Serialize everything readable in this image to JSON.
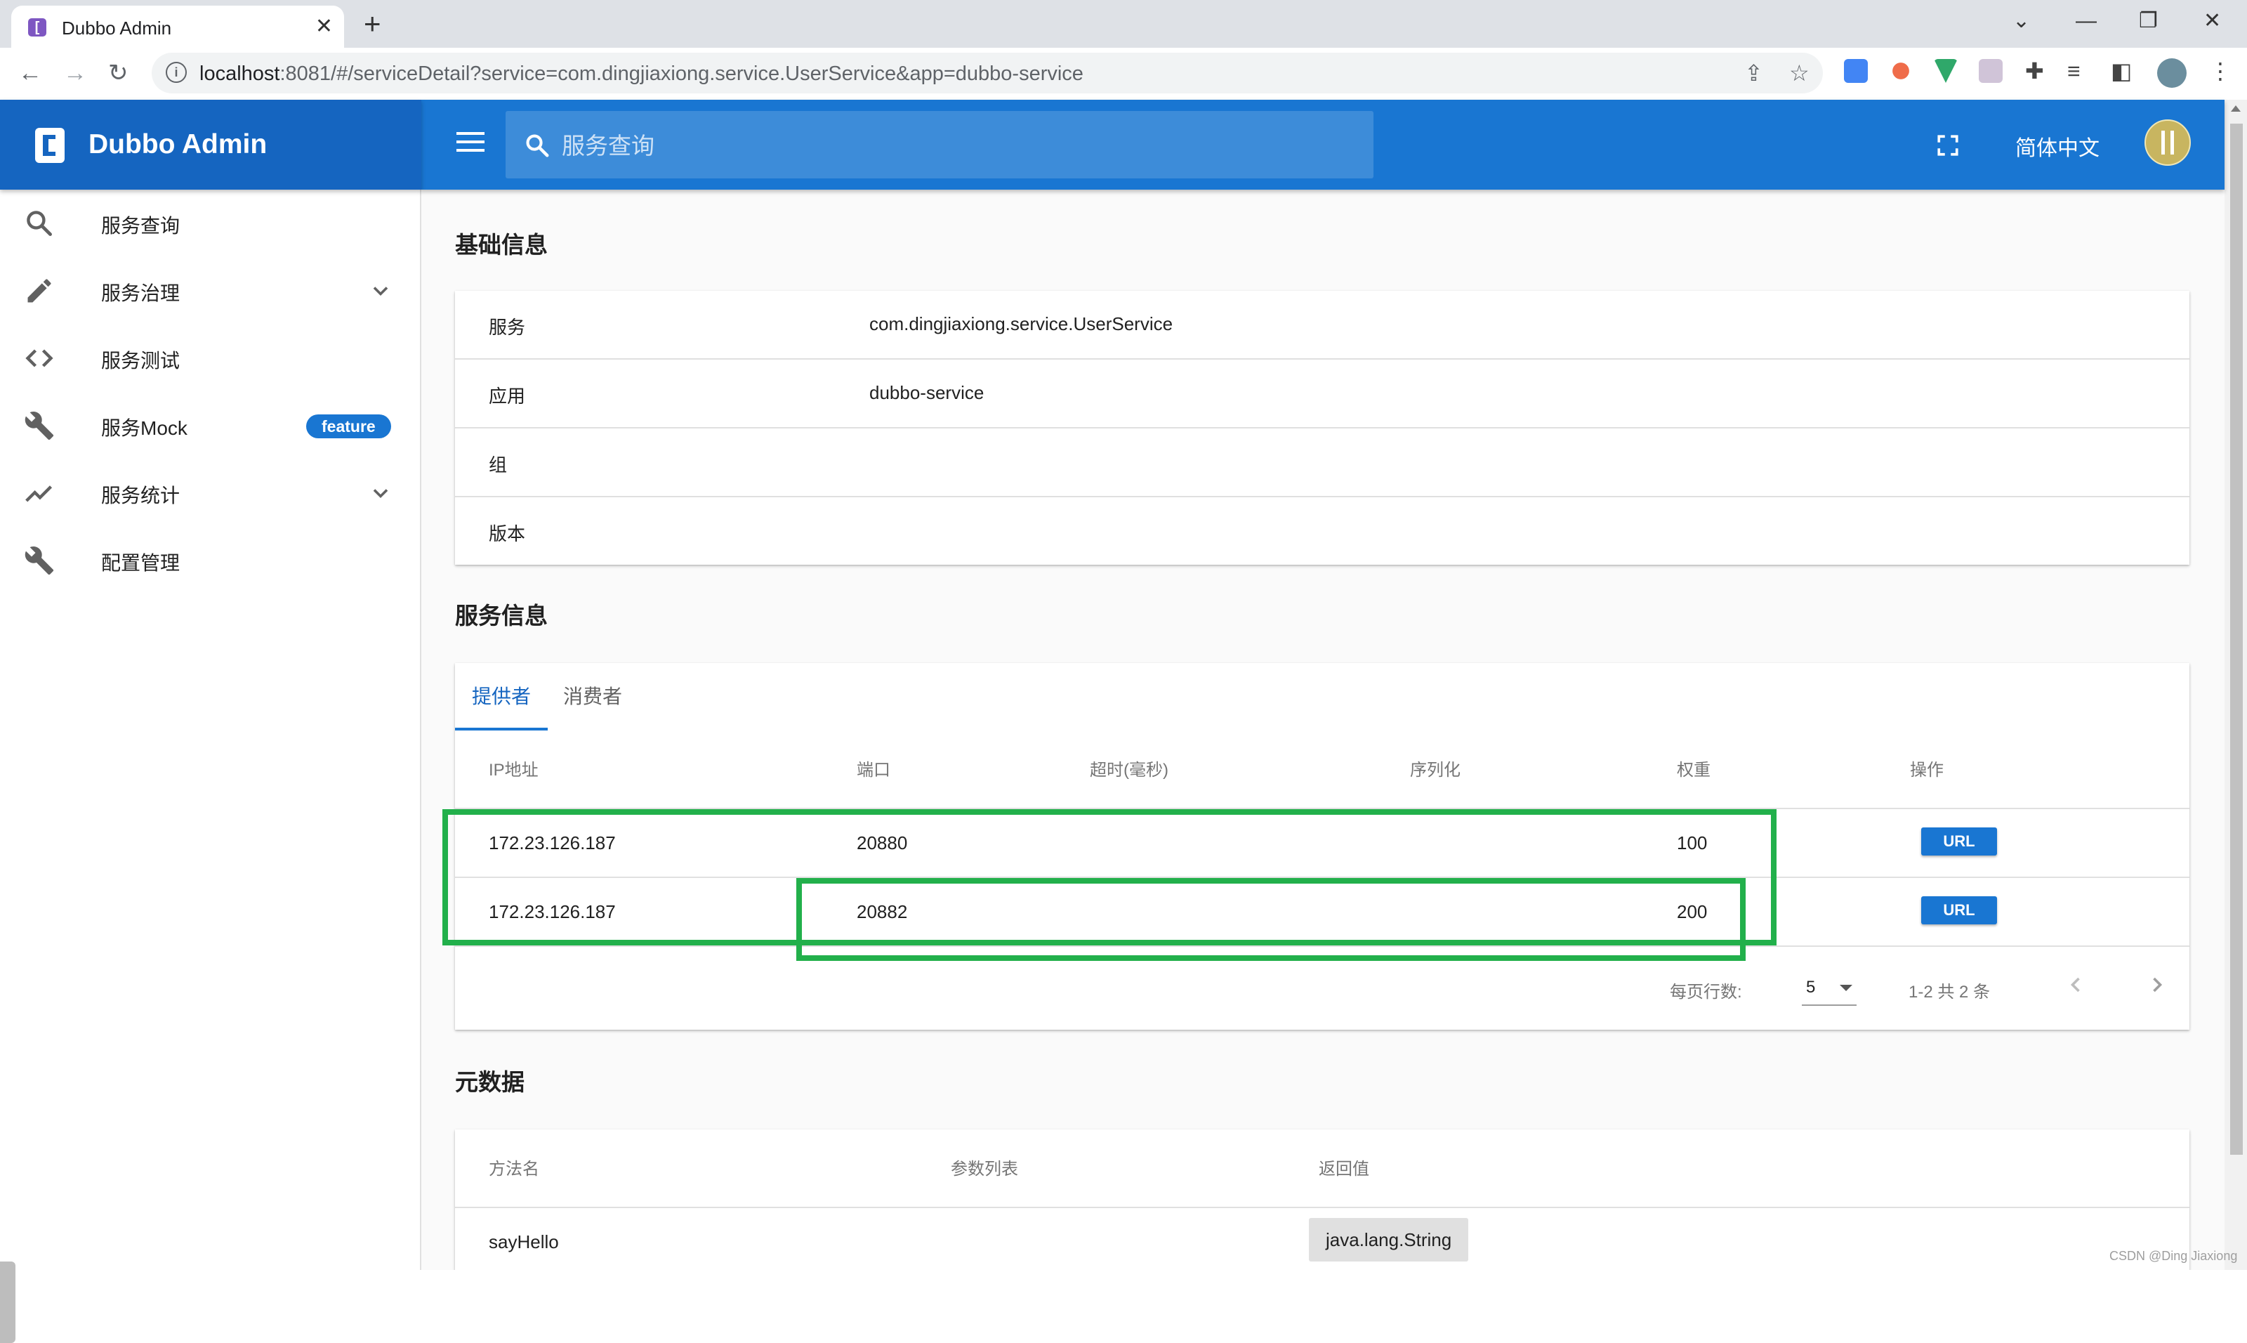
{
  "browser": {
    "tab_title": "Dubbo Admin",
    "tab_favicon": "[",
    "close_tab": "✕",
    "new_tab": "+",
    "window_controls": [
      "⌄",
      "—",
      "❐",
      "✕"
    ],
    "nav": {
      "back": "←",
      "forward": "→",
      "reload": "↻"
    },
    "url_host": "localhost",
    "url_rest": ":8081/#/serviceDetail?service=com.dingjiaxiong.service.UserService&app=dubbo-service"
  },
  "app": {
    "brand_name": "Dubbo Admin",
    "search_placeholder": "服务查询",
    "language": "简体中文"
  },
  "sidebar": {
    "items": [
      {
        "label": "服务查询",
        "icon": "search-icon"
      },
      {
        "label": "服务治理",
        "icon": "pencil-icon",
        "expandable": true
      },
      {
        "label": "服务测试",
        "icon": "code-icon"
      },
      {
        "label": "服务Mock",
        "icon": "wrench-icon",
        "badge": "feature"
      },
      {
        "label": "服务统计",
        "icon": "trending-icon",
        "expandable": true
      },
      {
        "label": "配置管理",
        "icon": "wrench-icon"
      }
    ]
  },
  "basic_info": {
    "title": "基础信息",
    "rows": [
      {
        "key": "服务",
        "value": "com.dingjiaxiong.service.UserService"
      },
      {
        "key": "应用",
        "value": "dubbo-service"
      },
      {
        "key": "组",
        "value": ""
      },
      {
        "key": "版本",
        "value": ""
      }
    ]
  },
  "service_info": {
    "title": "服务信息",
    "tabs": [
      "提供者",
      "消费者"
    ],
    "active_tab": 0,
    "columns": [
      "IP地址",
      "端口",
      "超时(毫秒)",
      "序列化",
      "权重",
      "操作"
    ],
    "rows": [
      {
        "ip": "172.23.126.187",
        "port": "20880",
        "timeout": "",
        "serialization": "",
        "weight": "100",
        "action": "URL"
      },
      {
        "ip": "172.23.126.187",
        "port": "20882",
        "timeout": "",
        "serialization": "",
        "weight": "200",
        "action": "URL"
      }
    ],
    "pagination": {
      "rows_per_page_label": "每页行数:",
      "rows_per_page": "5",
      "range": "1-2 共 2 条"
    }
  },
  "metadata": {
    "title": "元数据",
    "columns": [
      "方法名",
      "参数列表",
      "返回值"
    ],
    "rows": [
      {
        "method": "sayHello",
        "params": "",
        "return_type": "java.lang.String"
      }
    ]
  },
  "watermark": "CSDN @Ding Jiaxiong",
  "colors": {
    "primary": "#1976d2",
    "brand_dark": "#1565c0",
    "highlight": "#22b04b"
  }
}
